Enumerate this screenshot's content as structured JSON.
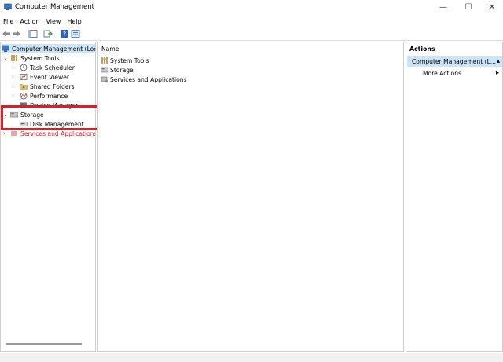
{
  "window": {
    "title": "Computer Management",
    "controls": {
      "minimize": "—",
      "maximize": "☐",
      "close": "✕"
    }
  },
  "menu": [
    "File",
    "Action",
    "View",
    "Help"
  ],
  "tree": {
    "root": "Computer Management (Local",
    "system_tools": "System Tools",
    "task_scheduler": "Task Scheduler",
    "event_viewer": "Event Viewer",
    "shared_folders": "Shared Folders",
    "performance": "Performance",
    "device_manager": "Device Manager",
    "storage": "Storage",
    "disk_management": "Disk Management",
    "services_and_applications": "Services and Applications"
  },
  "main": {
    "column_name": "Name",
    "items": [
      "System Tools",
      "Storage",
      "Services and Applications"
    ]
  },
  "actions": {
    "title": "Actions",
    "group": "Computer Management (L...",
    "more_actions": "More Actions"
  },
  "colors": {
    "selection": "#cce4f7",
    "highlight_box": "#d6202e"
  }
}
